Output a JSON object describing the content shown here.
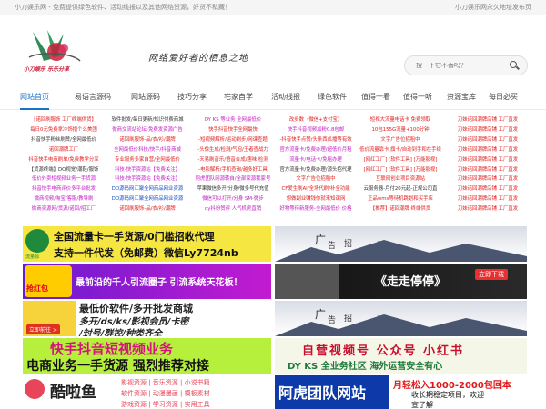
{
  "topbar": {
    "left": "小刀娱乐网 - 免费提供绿色软件、活动线报以及其他网络资源，好货不私藏！",
    "right": "小刀娱乐网永久地址发布页"
  },
  "header": {
    "logo_text": "小刀娱乐 乐乐分享",
    "slogan": "网络爱好者的栖息之地",
    "search_placeholder": "搜一下它不香吗？"
  },
  "nav": [
    "网站首页",
    "易语言源码",
    "网站源码",
    "技巧分享",
    "宅家自学",
    "活动线报",
    "绿色软件",
    "值得一看",
    "值得一听",
    "资源宝库",
    "每日必买"
  ],
  "links": [
    [
      {
        "t": "【诺回刷服饰 工厂终端供货】",
        "c": "#e02020"
      },
      {
        "t": "软件批发/每日更新/知识付费商城",
        "c": "#333"
      },
      {
        "t": "DY KS 等业务 全网最低价",
        "c": "#c020c0"
      },
      {
        "t": "改步数（微信+支付宝）",
        "c": "#e02020"
      },
      {
        "t": "短视大流量电话卡 免费领取",
        "c": "#e02020"
      },
      {
        "t": "刀妹诺回潮牌店铺 工厂直发",
        "c": "#e02020"
      }
    ],
    [
      {
        "t": "每日0元免费拿冷饰播个么美团",
        "c": "#e02020"
      },
      {
        "t": "微商交流站论坛-免费发资源广告",
        "c": "#c020c0"
      },
      {
        "t": "快手抖音快手全网最快",
        "c": "#e02020"
      },
      {
        "t": "快手抖音视频加粉0.8包邮",
        "c": "#c020c0"
      },
      {
        "t": "10包155G流量+100分钟",
        "c": "#e02020"
      },
      {
        "t": "刀妹诺回潮牌店铺 工厂直发",
        "c": "#e02020"
      }
    ],
    [
      {
        "t": "抖音快手粉丝刷赞/全网最低价",
        "c": "#333"
      },
      {
        "t": "诺回刷服饰-品/衣/衫/潮牌",
        "c": "#e02020"
      },
      {
        "t": "-短视频解析/运动刷步/网课查题",
        "c": "#e02020"
      },
      {
        "t": "-抖音快手点赞/头条西瓜播等有效",
        "c": "#e02020"
      },
      {
        "t": "文字广告位招租中",
        "c": "#e02020"
      },
      {
        "t": "刀妹诺回潮牌店铺 工厂直发",
        "c": "#e02020"
      }
    ],
    [
      {
        "t": "诺回潮牌工厂",
        "c": "#e02020"
      },
      {
        "t": "全网最低价科技/快手/抖音商城",
        "c": "#c020c0"
      },
      {
        "t": "-头像生成/检测/气泡/王者查战力",
        "c": "#e02020"
      },
      {
        "t": "官方流量卡/免费办理/超低价月租",
        "c": "#c020c0"
      },
      {
        "t": "低价流量靠卡 旗卡/自动到手和在手续",
        "c": "#e02020"
      },
      {
        "t": "刀妹诺回潮牌店铺 工厂直发",
        "c": "#e02020"
      }
    ],
    [
      {
        "t": "抖音快手电商刷单/免费教学分享",
        "c": "#e02020"
      },
      {
        "t": "专业服务多家自营/全网最低价",
        "c": "#e02020"
      },
      {
        "t": "-天易刷音乐/语音合成/趣味 检测",
        "c": "#e02020"
      },
      {
        "t": "流量卡/电话卡/免租办理",
        "c": "#c020c0"
      },
      {
        "t": "[网红工厂] [软件工具] [万能影视]",
        "c": "#e02020"
      },
      {
        "t": "刀妹诺回潮牌店铺 工厂直发",
        "c": "#e02020"
      }
    ],
    [
      {
        "t": "【货源终端】DO视觉/潮鞋/服饰",
        "c": "#333"
      },
      {
        "t": "科技-快手资源站【免费关注】",
        "c": "#c020c0"
      },
      {
        "t": "-电影解析/手机查询/越多好工具",
        "c": "#e02020"
      },
      {
        "t": "官方流量卡/免费办理/源头招代理",
        "c": "#333"
      },
      {
        "t": "[网红工厂] [软件工具] [万能影视]",
        "c": "#e02020"
      },
      {
        "t": "刀妹诺回潮牌店铺 工厂直发",
        "c": "#e02020"
      }
    ],
    [
      {
        "t": "低价外卖短视频业务一手货源",
        "c": "#c020c0"
      },
      {
        "t": "科技-快手资源站【免费关注】",
        "c": "#c020c0"
      },
      {
        "t": "阿虎团队网源转自/全部家源我家号",
        "c": "#c020c0"
      },
      {
        "t": "文字广告位招租中",
        "c": "#e02020"
      },
      {
        "t": "互联网创业项目资源站",
        "c": "#e02020"
      },
      {
        "t": "刀妹诺回潮牌店铺 工厂直发",
        "c": "#e02020"
      }
    ],
    [
      {
        "t": "抖音快手电商评价多平台批发",
        "c": "#c020c0"
      },
      {
        "t": "DO源码网汇聚全网商品网业资源",
        "c": "#1a4fc9"
      },
      {
        "t": "苹果微信多开/分身/微多号代充值",
        "c": "#333"
      },
      {
        "t": "CF爱生刷AI/全场代刷/补全功能",
        "c": "#e02020"
      },
      {
        "t": "云服务器-月付20元起-正规公司直",
        "c": "#333"
      },
      {
        "t": "刀妹诺回潮牌店铺 工厂直发",
        "c": "#e02020"
      }
    ],
    [
      {
        "t": "微商视频/淘宝/客服/教导刷",
        "c": "#c020c0"
      },
      {
        "t": "DO源码网汇聚全网商品网业资源",
        "c": "#1a4fc9"
      },
      {
        "t": "微信可以打开/分身 SM-微步",
        "c": "#c020c0"
      },
      {
        "t": "想做副业赚钱你就来知课网",
        "c": "#e02020"
      },
      {
        "t": "正品wms等待机跳划和买手店",
        "c": "#e02020"
      },
      {
        "t": "刀妹诺回潮牌店铺 工厂直发",
        "c": "#e02020"
      }
    ],
    [
      {
        "t": "微商资源网/货源/诺回/招工厂",
        "c": "#c020c0"
      },
      {
        "t": "诺回刷服饰-品/衣/衫/潮牌",
        "c": "#e02020"
      },
      {
        "t": "dy抖粉赞评 人气机房直销",
        "c": "#c020c0"
      },
      {
        "t": "好物等待新服务-全网最低价 价格",
        "c": "#c020c0"
      },
      {
        "t": "【推荐】诺回潮牌 终端供货",
        "c": "#e02020"
      },
      {
        "t": "刀妹诺回潮牌店铺 工厂直发",
        "c": "#e02020"
      }
    ]
  ],
  "banners": {
    "b1_brand": "流量源",
    "b1_line1": "全国流量卡一手货源/0门槛招收代理",
    "b1_line2": "支持一件代发（免邮费）微信Ly7724nb",
    "ad_a": "广",
    "ad_b": "告",
    "ad_c": "招",
    "ad_d": "租",
    "b2_text": "最前沿的千人引流圈子 引流系统天花板！",
    "b2_badge": "抢红包",
    "b2r_text": "《走走停停》",
    "b2r_sub": "立即下载",
    "b3_line1": "最低价软件/多开批发商城",
    "b3_line2": "多开/ds/ks/影视会员/卡密",
    "b3_line3": "/封号/群控/种类齐全",
    "b3_btn": "立即前往 >",
    "b4_line1": "快手抖音短视频业务",
    "b4_line2": "电商业务一手货源 强烈推荐对接",
    "b4r_line1": "自营视频号 公众号 小红书",
    "b4r_line2": "DY KS 全业务社区 海外运营安全有心",
    "b5_brand": "酷啦鱼",
    "b5_items": "影视资源 | 音乐资源 | 小说书籍",
    "b5_items2": "软件资源 | 动漫漫画 | 模板素材",
    "b5_items3": "游戏资源 | 学习资源 | 实用工具",
    "b5r_title": "阿虎团队网站",
    "b5r_hl": "月轻松入1000-2000包回本",
    "b5r_sub": "收长期稳定项目，欢迎",
    "b5r_sub2": "宣了解"
  }
}
